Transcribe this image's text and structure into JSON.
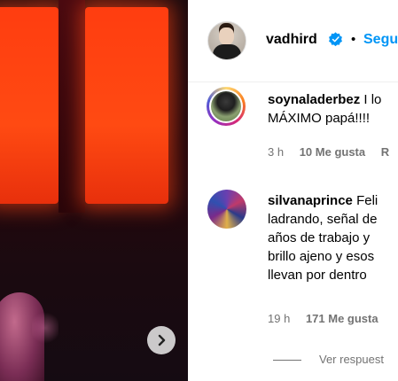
{
  "post": {
    "author": "vadhird",
    "follow_label": "Segu",
    "separator": "•"
  },
  "comments": [
    {
      "username": "soynaladerbez",
      "lines": [
        "I lo",
        "MÁXIMO papá!!!!"
      ],
      "time": "3 h",
      "likes": "10 Me gusta",
      "reply": "R"
    },
    {
      "username": "silvanaprince",
      "lines": [
        "Feli",
        "ladrando, señal de",
        "años de trabajo y",
        "brillo ajeno y esos",
        "llevan por dentro"
      ],
      "time": "19 h",
      "likes": "171 Me gusta",
      "reply": ""
    }
  ],
  "view_replies": "Ver respuest",
  "icons": {
    "next": "chevron-right-icon",
    "verified": "verified-badge-icon"
  },
  "colors": {
    "follow": "#0095f6",
    "verified": "#0095f6",
    "meta": "#737373"
  }
}
